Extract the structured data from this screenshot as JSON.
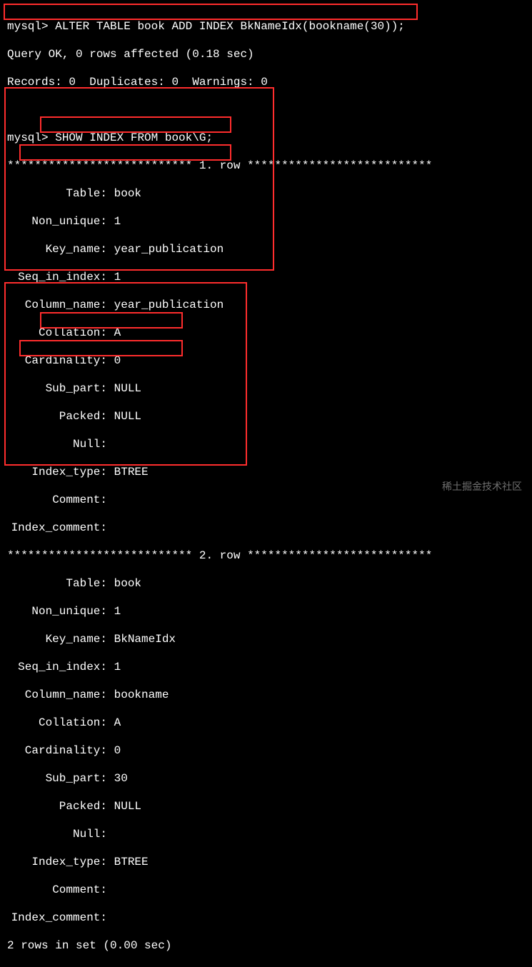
{
  "prompt": "mysql>",
  "cmd1": "ALTER TABLE book ADD INDEX BkNameIdx(bookname(30));",
  "result1a": "Query OK, 0 rows affected (0.18 sec)",
  "result1b": "Records: 0  Duplicates: 0  Warnings: 0",
  "cmd2": "SHOW INDEX FROM book\\G;",
  "row_sep_prefix": "***************************",
  "row_sep_suffix": "***************************",
  "row1_label": " 1. row ",
  "row2_label": " 2. row ",
  "rows": [
    {
      "Table": "book",
      "Non_unique": "1",
      "Key_name": "year_publication",
      "Seq_in_index": "1",
      "Column_name": "year_publication",
      "Collation": "A",
      "Cardinality": "0",
      "Sub_part": "NULL",
      "Packed": "NULL",
      "Null": "",
      "Index_type": "BTREE",
      "Comment": "",
      "Index_comment": ""
    },
    {
      "Table": "book",
      "Non_unique": "1",
      "Key_name": "BkNameIdx",
      "Seq_in_index": "1",
      "Column_name": "bookname",
      "Collation": "A",
      "Cardinality": "0",
      "Sub_part": "30",
      "Packed": "NULL",
      "Null": "",
      "Index_type": "BTREE",
      "Comment": "",
      "Index_comment": ""
    }
  ],
  "summary": "2 rows in set (0.00 sec)",
  "watermark": "稀土掘金技术社区",
  "fields_order": [
    "Table",
    "Non_unique",
    "Key_name",
    "Seq_in_index",
    "Column_name",
    "Collation",
    "Cardinality",
    "Sub_part",
    "Packed",
    "Null",
    "Index_type",
    "Comment",
    "Index_comment"
  ]
}
